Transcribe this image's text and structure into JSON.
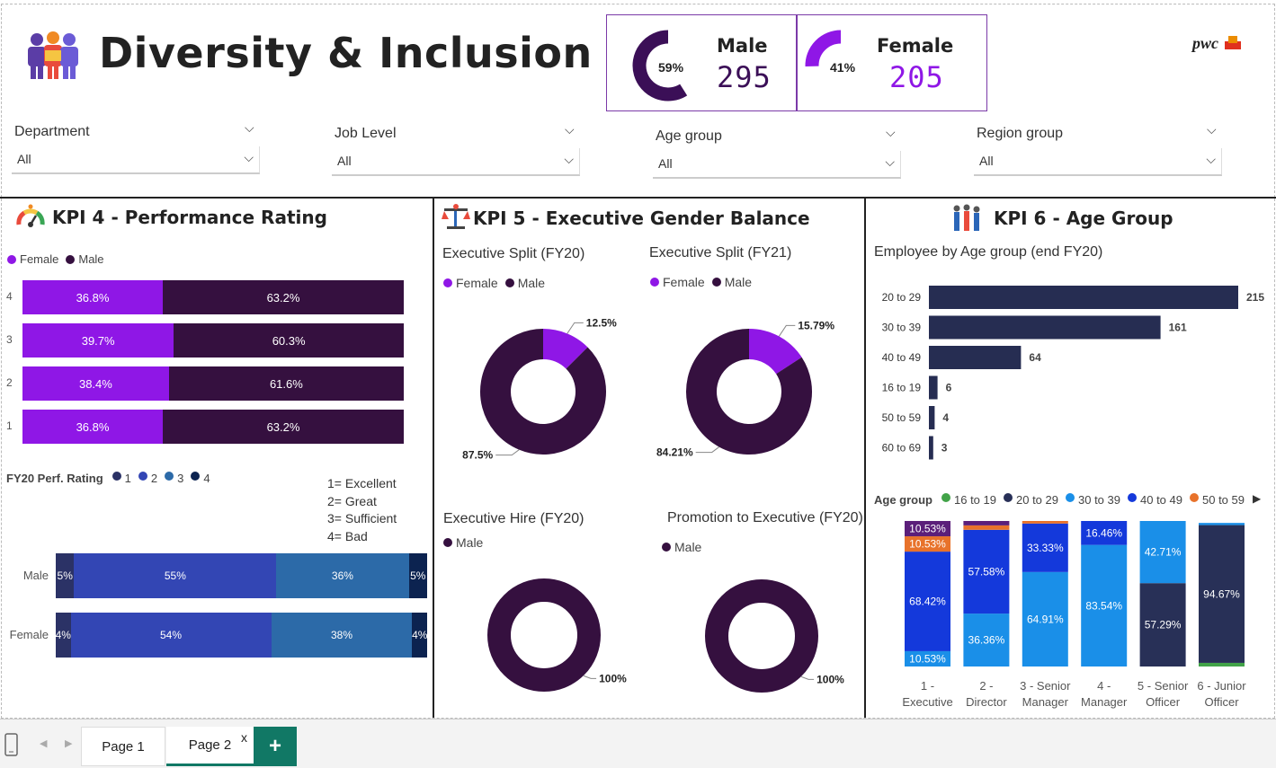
{
  "header": {
    "title": "Diversity & Inclusion",
    "brand": "pwc"
  },
  "cards": [
    {
      "label": "Male",
      "value": "295",
      "pct_label": "59%",
      "pct": 0.59,
      "color": "#3b0f57"
    },
    {
      "label": "Female",
      "value": "205",
      "pct_label": "41%",
      "pct": 0.41,
      "color": "#8f17e6"
    }
  ],
  "slicers": [
    {
      "label": "Department",
      "value": "All"
    },
    {
      "label": "Job Level",
      "value": "All"
    },
    {
      "label": "Age group",
      "value": "All"
    },
    {
      "label": "Region group",
      "value": "All"
    }
  ],
  "colors": {
    "female": "#8f17e6",
    "male": "#35103f",
    "dark_navy": "#283057",
    "navy_bar": "#262d52",
    "r1": "#2b3266",
    "r2": "#3346b4",
    "r3": "#2c6aa8",
    "r4": "#0c2350"
  },
  "kpi4": {
    "title": "KPI 4 - Performance Rating",
    "legend": [
      "Female",
      "Male"
    ],
    "perf_title": "FY20 Perf. Rating",
    "perf_legend": [
      "1",
      "2",
      "3",
      "4"
    ],
    "notes": [
      "1= Excellent",
      "2= Great",
      "3= Sufficient",
      "4= Bad"
    ]
  },
  "kpi5": {
    "title": "KPI 5 - Executive Gender Balance",
    "charts": [
      {
        "title": "Executive Split (FY20)",
        "legend": [
          "Female",
          "Male"
        ]
      },
      {
        "title": "Executive Split (FY21)",
        "legend": [
          "Female",
          "Male"
        ]
      },
      {
        "title": "Executive Hire (FY20)",
        "legend": [
          "Male"
        ]
      },
      {
        "title": "Promotion to Executive (FY20)",
        "legend": [
          "Male"
        ]
      }
    ]
  },
  "kpi6": {
    "title": "KPI 6 - Age Group",
    "subtitle": "Employee by Age group (end FY20)",
    "legend_title": "Age group",
    "legend": [
      "16 to 19",
      "20 to 29",
      "30 to 39",
      "40 to 49",
      "50 to 59"
    ]
  },
  "chart_data": [
    {
      "type": "bar",
      "orientation": "horizontal",
      "stacked": "100%",
      "categories": [
        "4",
        "3",
        "2",
        "1"
      ],
      "series": [
        {
          "name": "Female",
          "values": [
            36.8,
            39.7,
            38.4,
            36.8
          ],
          "labels": [
            "36.8%",
            "39.7%",
            "38.4%",
            "36.8%"
          ]
        },
        {
          "name": "Male",
          "values": [
            63.2,
            60.3,
            61.6,
            63.2
          ],
          "labels": [
            "63.2%",
            "60.3%",
            "61.6%",
            "63.2%"
          ]
        }
      ]
    },
    {
      "type": "bar",
      "orientation": "horizontal",
      "stacked": "100%",
      "categories": [
        "Male",
        "Female"
      ],
      "series": [
        {
          "name": "1",
          "values": [
            5,
            4
          ],
          "labels": [
            "5%",
            "4%"
          ]
        },
        {
          "name": "2",
          "values": [
            55,
            54
          ],
          "labels": [
            "55%",
            "54%"
          ]
        },
        {
          "name": "3",
          "values": [
            36,
            38
          ],
          "labels": [
            "36%",
            "38%"
          ]
        },
        {
          "name": "4",
          "values": [
            5,
            4
          ],
          "labels": [
            "5%",
            "4%"
          ]
        }
      ]
    },
    {
      "type": "pie",
      "donut": true,
      "title": "Executive Split (FY20)",
      "slices": [
        {
          "name": "Female",
          "value": 12.5,
          "label": "12.5%"
        },
        {
          "name": "Male",
          "value": 87.5,
          "label": "87.5%"
        }
      ]
    },
    {
      "type": "pie",
      "donut": true,
      "title": "Executive Split (FY21)",
      "slices": [
        {
          "name": "Female",
          "value": 15.79,
          "label": "15.79%"
        },
        {
          "name": "Male",
          "value": 84.21,
          "label": "84.21%"
        }
      ]
    },
    {
      "type": "pie",
      "donut": true,
      "title": "Executive Hire (FY20)",
      "slices": [
        {
          "name": "Male",
          "value": 100,
          "label": "100%"
        }
      ]
    },
    {
      "type": "pie",
      "donut": true,
      "title": "Promotion to Executive (FY20)",
      "slices": [
        {
          "name": "Male",
          "value": 100,
          "label": "100%"
        }
      ]
    },
    {
      "type": "bar",
      "orientation": "horizontal",
      "title": "Employee by Age group (end FY20)",
      "categories": [
        "20 to 29",
        "30 to 39",
        "40 to 49",
        "16 to 19",
        "50 to 59",
        "60 to 69"
      ],
      "values": [
        215,
        161,
        64,
        6,
        4,
        3
      ],
      "xlim": [
        0,
        215
      ]
    },
    {
      "type": "bar",
      "stacked": "100%",
      "categories": [
        "1 - Executive",
        "2 - Director",
        "3 - Senior Manager",
        "4 - Manager",
        "5 - Senior Officer",
        "6 - Junior Officer"
      ],
      "category_lines": [
        [
          "1 -",
          "Executive"
        ],
        [
          "2 -",
          "Director"
        ],
        [
          "3 - Senior",
          "Manager"
        ],
        [
          "4 -",
          "Manager"
        ],
        [
          "5 - Senior",
          "Officer"
        ],
        [
          "6 - Junior",
          "Officer"
        ]
      ],
      "series": [
        {
          "name": "16 to 19",
          "values": [
            0,
            0,
            0,
            0,
            0,
            2.5
          ],
          "labels": [
            "",
            "",
            "",
            "",
            "",
            ""
          ]
        },
        {
          "name": "20 to 29",
          "values": [
            0,
            0,
            0,
            0,
            57.29,
            94.67
          ],
          "labels": [
            "",
            "",
            "",
            "",
            "57.29%",
            "94.67%"
          ]
        },
        {
          "name": "30 to 39",
          "values": [
            10.53,
            36.36,
            64.91,
            83.54,
            42.71,
            1.5
          ],
          "labels": [
            "10.53%",
            "36.36%",
            "64.91%",
            "83.54%",
            "42.71%",
            ""
          ]
        },
        {
          "name": "40 to 49",
          "values": [
            68.42,
            57.58,
            33.33,
            16.46,
            0,
            0
          ],
          "labels": [
            "68.42%",
            "57.58%",
            "33.33%",
            "16.46%",
            "",
            ""
          ]
        },
        {
          "name": "50 to 59",
          "values": [
            10.53,
            3.03,
            1.76,
            0,
            0,
            0
          ],
          "labels": [
            "10.53%",
            "",
            "",
            "",
            "",
            ""
          ]
        },
        {
          "name": "60 to 69",
          "values": [
            10.53,
            3.03,
            0,
            0,
            0,
            0
          ],
          "labels": [
            "10.53%",
            "",
            "",
            "",
            "",
            ""
          ]
        }
      ]
    }
  ],
  "footer": {
    "tabs": [
      "Page 1",
      "Page 2"
    ],
    "active": "Page 2",
    "close": "x",
    "add": "+"
  }
}
